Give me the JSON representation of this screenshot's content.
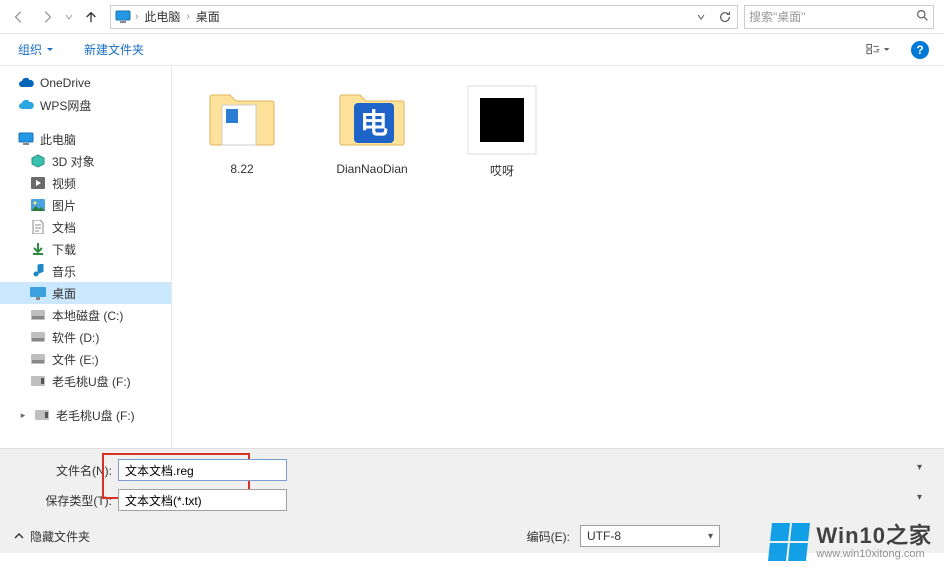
{
  "nav": {
    "breadcrumb": [
      "此电脑",
      "桌面"
    ],
    "search_placeholder": "搜索\"桌面\""
  },
  "toolbar": {
    "organize": "组织",
    "new_folder": "新建文件夹"
  },
  "tree": {
    "onedrive": "OneDrive",
    "wps": "WPS网盘",
    "thispc": "此电脑",
    "objects3d": "3D 对象",
    "videos": "视频",
    "pictures": "图片",
    "documents": "文档",
    "downloads": "下载",
    "music": "音乐",
    "desktop": "桌面",
    "localc": "本地磁盘 (C:)",
    "softd": "软件 (D:)",
    "docse": "文件 (E:)",
    "udiskf1": "老毛桃U盘 (F:)",
    "udiskf2": "老毛桃U盘 (F:)"
  },
  "files": {
    "f1": "8.22",
    "f2": "DianNaoDian",
    "f3": "哎呀"
  },
  "save": {
    "filename_label": "文件名(N):",
    "filename_value": "文本文档.reg",
    "filetype_label": "保存类型(T):",
    "filetype_value": "文本文档(*.txt)",
    "hide_folders": "隐藏文件夹",
    "encoding_label": "编码(E):",
    "encoding_value": "UTF-8"
  },
  "watermark": {
    "title": "Win10之家",
    "url": "www.win10xitong.com"
  }
}
